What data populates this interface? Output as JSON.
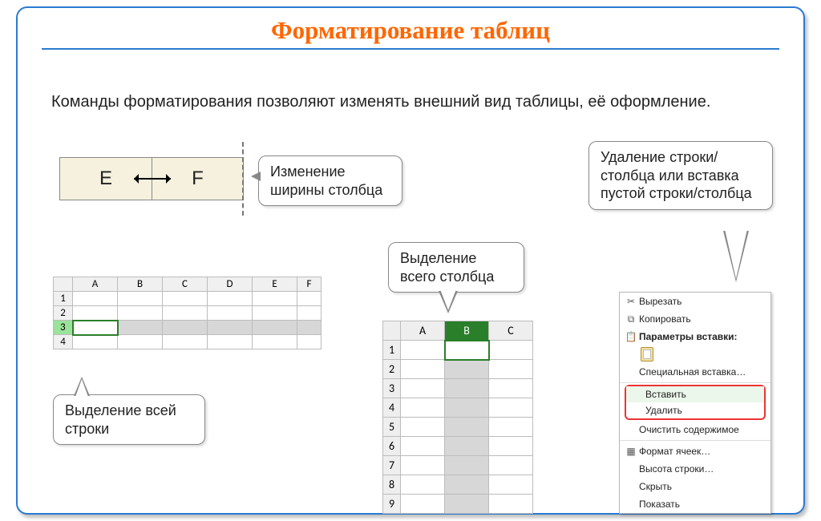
{
  "title": "Форматирование таблиц",
  "intro": "Команды форматирования позволяют изменять внешний вид таблицы, её оформление.",
  "callouts": {
    "width": "Изменение ширины столбца",
    "select_col": "Выделение всего столбца",
    "select_row": "Выделение всей строки",
    "context": "Удаление строки/столбца или вставка пустой строки/столбца"
  },
  "illus1": {
    "cols": [
      "E",
      "F"
    ]
  },
  "grid1": {
    "cols": [
      "A",
      "B",
      "C",
      "D",
      "E",
      "F"
    ],
    "rows": [
      "1",
      "2",
      "3",
      "4"
    ],
    "selected_row": "3"
  },
  "grid2": {
    "cols": [
      "A",
      "B",
      "C"
    ],
    "rows": [
      "1",
      "2",
      "3",
      "4",
      "5",
      "6",
      "7",
      "8",
      "9"
    ],
    "selected_col": "B"
  },
  "context_menu": {
    "cut": "Вырезать",
    "copy": "Копировать",
    "paste_params": "Параметры вставки:",
    "paste_special": "Специальная вставка…",
    "insert": "Вставить",
    "delete": "Удалить",
    "clear": "Очистить содержимое",
    "format_cells": "Формат ячеек…",
    "row_height": "Высота строки…",
    "hide": "Скрыть",
    "show": "Показать"
  }
}
